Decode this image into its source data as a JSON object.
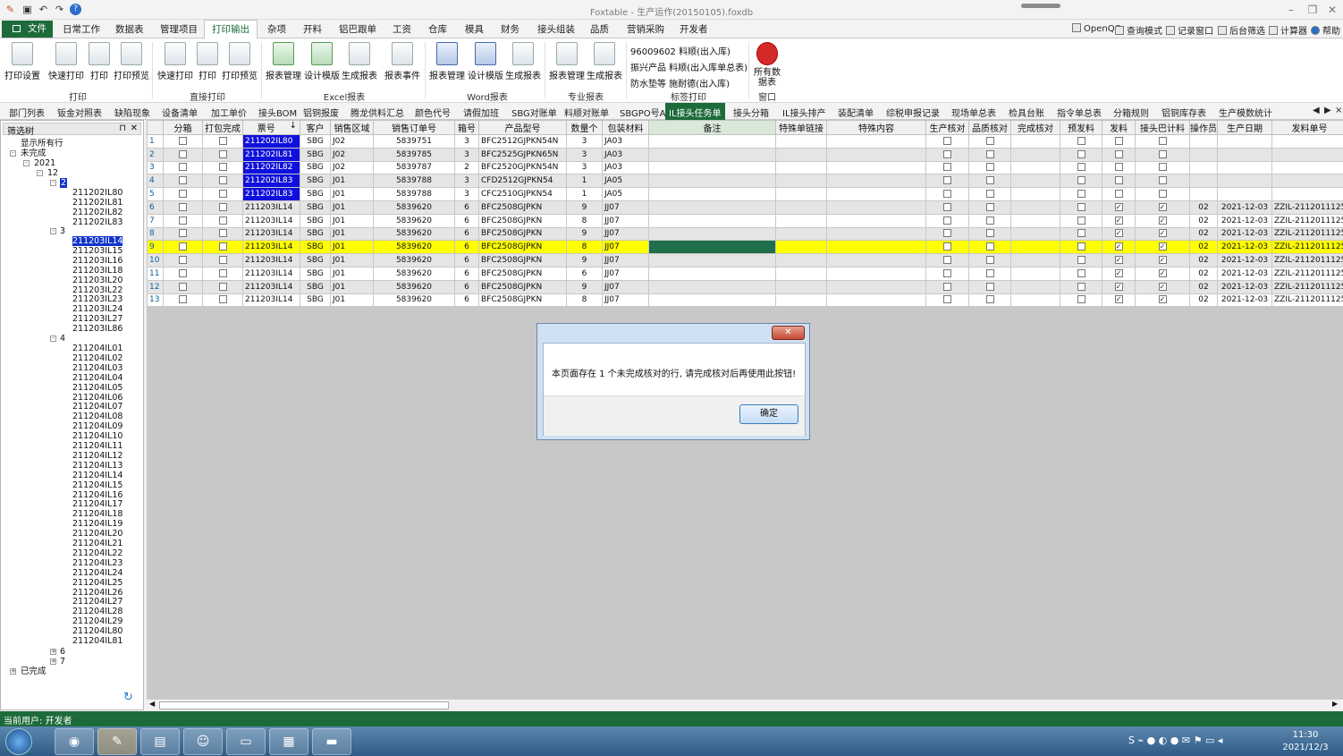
{
  "window": {
    "title": "Foxtable - 生产运作(20150105).foxdb"
  },
  "menu": {
    "file": "文件",
    "items": [
      "日常工作",
      "数据表",
      "管理项目",
      "打印输出",
      "杂项",
      "开料",
      "铝巴跟单",
      "工资",
      "仓库",
      "模具",
      "财务",
      "接头组装",
      "品质",
      "营销采购",
      "开发者"
    ],
    "active": "打印输出",
    "right_tools": [
      "OpenQQ",
      "查询模式",
      "记录窗口",
      "后台筛选",
      "计算器",
      "帮助"
    ]
  },
  "ribbon": {
    "groups": [
      {
        "label": "打印",
        "buttons": [
          "打印设置",
          "快速打印",
          "打印",
          "打印预览"
        ]
      },
      {
        "label": "直接打印",
        "buttons": [
          "快速打印",
          "打印",
          "打印预览"
        ]
      },
      {
        "label": "Excel报表",
        "buttons": [
          "报表管理",
          "设计模版",
          "生成报表",
          "报表事件"
        ]
      },
      {
        "label": "Word报表",
        "buttons": [
          "报表管理",
          "设计模版",
          "生成报表"
        ]
      },
      {
        "label": "专业报表",
        "buttons": [
          "报表管理",
          "生成报表"
        ]
      },
      {
        "label": "标签打印",
        "items": [
          "96009602  料顺(出入库)",
          "振兴产品  料顺(出入库单总表)",
          "防水垫等  施耐德(出入库)"
        ]
      },
      {
        "label": "窗口",
        "buttons": [
          "所有数据表"
        ]
      }
    ]
  },
  "navtabs": {
    "items": [
      "部门列表",
      "钣金对照表",
      "缺陷现象",
      "设备清单",
      "加工单价",
      "接头BOM",
      "铝铜报废",
      "腾龙供料汇总",
      "颜色代号",
      "请假加班",
      "SBG对账单",
      "料顺对账单",
      "SBGPO号A",
      "IL接头任务单",
      "接头分箱",
      "IL接头排产",
      "装配清单",
      "综税申报记录",
      "现场单总表",
      "检具台账",
      "指令单总表",
      "分箱规则",
      "铝铜库存表",
      "生产模数统计"
    ],
    "active": "IL接头任务单"
  },
  "filter_tree": {
    "title": "筛选树",
    "show_all": "显示所有行",
    "unfinished": "未完成",
    "year": "2021",
    "month12": "12",
    "group2": "2",
    "group2_items": [
      "211202IL80",
      "211202IL81",
      "211202IL82",
      "211202IL83"
    ],
    "group3": "3",
    "group3_items": [
      "211203IL14",
      "211203IL15",
      "211203IL16",
      "211203IL18",
      "211203IL20",
      "211203IL22",
      "211203IL23",
      "211203IL24",
      "211203IL27",
      "211203IL86"
    ],
    "group4": "4",
    "group4_items": [
      "211204IL01",
      "211204IL02",
      "211204IL03",
      "211204IL04",
      "211204IL05",
      "211204IL06",
      "211204IL07",
      "211204IL08",
      "211204IL09",
      "211204IL10",
      "211204IL11",
      "211204IL12",
      "211204IL13",
      "211204IL14",
      "211204IL15",
      "211204IL16",
      "211204IL17",
      "211204IL18",
      "211204IL19",
      "211204IL20",
      "211204IL21",
      "211204IL22",
      "211204IL23",
      "211204IL24",
      "211204IL25",
      "211204IL26",
      "211204IL27",
      "211204IL28",
      "211204IL29",
      "211204IL80",
      "211204IL81"
    ],
    "group6": "6",
    "group7": "7",
    "finished": "已完成"
  },
  "grid": {
    "headers": [
      "",
      "分箱",
      "打包完成",
      "票号",
      "客户",
      "销售区域",
      "销售订单号",
      "箱号",
      "产品型号",
      "数量个",
      "包装材料",
      "备注",
      "特殊单链接",
      "特殊内容",
      "生产核对",
      "品质核对",
      "完成核对",
      "预发料",
      "发料",
      "接头巴计料",
      "操作员",
      "生产日期",
      "发料单号"
    ],
    "sort_indicator": "↓",
    "rows": [
      {
        "n": "1",
        "ticket": "211202IL80",
        "cust": "SBG",
        "area": "J02",
        "order": "5839751",
        "box": "3",
        "model": "BFC2512GJPKN54N",
        "qty": "3",
        "pack": "JA03",
        "issue": false,
        "bar": false,
        "op": "",
        "date": "",
        "slip": ""
      },
      {
        "n": "2",
        "ticket": "211202IL81",
        "cust": "SBG",
        "area": "J02",
        "order": "5839785",
        "box": "3",
        "model": "BFC2525GJPKN65N",
        "qty": "3",
        "pack": "JA03",
        "issue": false,
        "bar": false,
        "op": "",
        "date": "",
        "slip": ""
      },
      {
        "n": "3",
        "ticket": "211202IL82",
        "cust": "SBG",
        "area": "J02",
        "order": "5839787",
        "box": "2",
        "model": "BFC2520GJPKN54N",
        "qty": "3",
        "pack": "JA03",
        "issue": false,
        "bar": false,
        "op": "",
        "date": "",
        "slip": ""
      },
      {
        "n": "4",
        "ticket": "211202IL83",
        "cust": "SBG",
        "area": "J01",
        "order": "5839788",
        "box": "3",
        "model": "CFD2512GJPKN54",
        "qty": "1",
        "pack": "JA05",
        "issue": false,
        "bar": false,
        "op": "",
        "date": "",
        "slip": ""
      },
      {
        "n": "5",
        "ticket": "211202IL83",
        "cust": "SBG",
        "area": "J01",
        "order": "5839788",
        "box": "3",
        "model": "CFC2510GJPKN54",
        "qty": "1",
        "pack": "JA05",
        "issue": false,
        "bar": false,
        "op": "",
        "date": "",
        "slip": ""
      },
      {
        "n": "6",
        "ticket": "211203IL14",
        "cust": "SBG",
        "area": "J01",
        "order": "5839620",
        "box": "6",
        "model": "BFC2508GJPKN",
        "qty": "9",
        "pack": "JJ07",
        "issue": true,
        "bar": true,
        "op": "02",
        "date": "2021-12-03",
        "slip": "ZZIL-2112011125"
      },
      {
        "n": "7",
        "ticket": "211203IL14",
        "cust": "SBG",
        "area": "J01",
        "order": "5839620",
        "box": "6",
        "model": "BFC2508GJPKN",
        "qty": "8",
        "pack": "JJ07",
        "issue": true,
        "bar": true,
        "op": "02",
        "date": "2021-12-03",
        "slip": "ZZIL-2112011125"
      },
      {
        "n": "8",
        "ticket": "211203IL14",
        "cust": "SBG",
        "area": "J01",
        "order": "5839620",
        "box": "6",
        "model": "BFC2508GJPKN",
        "qty": "9",
        "pack": "JJ07",
        "issue": true,
        "bar": true,
        "op": "02",
        "date": "2021-12-03",
        "slip": "ZZIL-2112011125"
      },
      {
        "n": "9",
        "ticket": "211203IL14",
        "cust": "SBG",
        "area": "J01",
        "order": "5839620",
        "box": "6",
        "model": "BFC2508GJPKN",
        "qty": "8",
        "pack": "JJ07",
        "issue": true,
        "bar": true,
        "op": "02",
        "date": "2021-12-03",
        "slip": "ZZIL-2112011125"
      },
      {
        "n": "10",
        "ticket": "211203IL14",
        "cust": "SBG",
        "area": "J01",
        "order": "5839620",
        "box": "6",
        "model": "BFC2508GJPKN",
        "qty": "9",
        "pack": "JJ07",
        "issue": true,
        "bar": true,
        "op": "02",
        "date": "2021-12-03",
        "slip": "ZZIL-2112011125"
      },
      {
        "n": "11",
        "ticket": "211203IL14",
        "cust": "SBG",
        "area": "J01",
        "order": "5839620",
        "box": "6",
        "model": "BFC2508GJPKN",
        "qty": "6",
        "pack": "JJ07",
        "issue": true,
        "bar": true,
        "op": "02",
        "date": "2021-12-03",
        "slip": "ZZIL-2112011125"
      },
      {
        "n": "12",
        "ticket": "211203IL14",
        "cust": "SBG",
        "area": "J01",
        "order": "5839620",
        "box": "6",
        "model": "BFC2508GJPKN",
        "qty": "9",
        "pack": "JJ07",
        "issue": true,
        "bar": true,
        "op": "02",
        "date": "2021-12-03",
        "slip": "ZZIL-2112011125"
      },
      {
        "n": "13",
        "ticket": "211203IL14",
        "cust": "SBG",
        "area": "J01",
        "order": "5839620",
        "box": "6",
        "model": "BFC2508GJPKN",
        "qty": "8",
        "pack": "JJ07",
        "issue": true,
        "bar": true,
        "op": "02",
        "date": "2021-12-03",
        "slip": "ZZIL-2112011125"
      }
    ],
    "highlight_row": "9",
    "colors": {
      "selected_ticket": "#1010dd",
      "highlight_row": "#ffff00",
      "note_cell": "#1f6f4a"
    }
  },
  "dialog": {
    "message": "本页面存在 1 个未完成核对的行, 请完成核对后再使用此按钮!",
    "ok": "确定",
    "close": "✕"
  },
  "status": {
    "text": "当前用户:  开发者"
  },
  "taskbar": {
    "time": "11:30",
    "date": "2021/12/3"
  },
  "colors": {
    "brand": "#1d6b3b"
  }
}
